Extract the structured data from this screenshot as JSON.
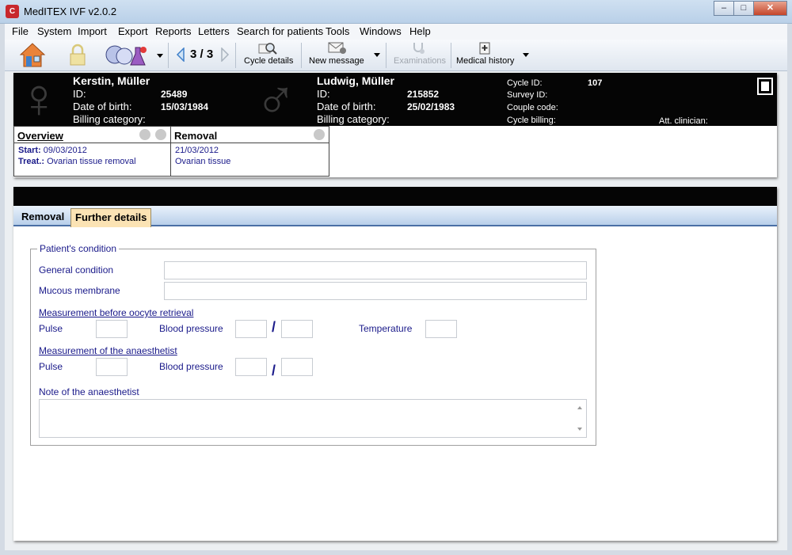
{
  "window": {
    "title": "MedITEX IVF v2.0.2",
    "app_icon_text": "C"
  },
  "menu": [
    "File",
    "System",
    "Import",
    "Export",
    "Reports",
    "Letters",
    "Search for patients",
    "Tools",
    "Windows",
    "Help"
  ],
  "toolbar": {
    "pager": "3 / 3",
    "cycle_details": "Cycle details",
    "new_message": "New message",
    "examinations": "Examinations",
    "medical_history": "Medical history"
  },
  "female": {
    "name": "Kerstin, Müller",
    "id_label": "ID:",
    "id": "25489",
    "dob_label": "Date of birth:",
    "dob": "15/03/1984",
    "billing_label": "Billing category:"
  },
  "male": {
    "name": "Ludwig, Müller",
    "id_label": "ID:",
    "id": "215852",
    "dob_label": "Date of birth:",
    "dob": "25/02/1983",
    "billing_label": "Billing category:"
  },
  "cycle": {
    "cycle_id_label": "Cycle ID:",
    "cycle_id": "107",
    "survey_id_label": "Survey ID:",
    "couple_code_label": "Couple code:",
    "cycle_billing_label": "Cycle billing:",
    "clinician_label": "Att. clinician:"
  },
  "overview": {
    "title": "Overview",
    "start_label": "Start:",
    "start": "09/03/2012",
    "treat_label": "Treat.:",
    "treat": "Ovarian tissue removal"
  },
  "removal_card": {
    "title": "Removal",
    "date": "21/03/2012",
    "desc": "Ovarian tissue"
  },
  "tabs": {
    "removal": "Removal",
    "further": "Further details"
  },
  "form": {
    "group_title": "Patient's condition",
    "general_condition": "General condition",
    "mucous_membrane": "Mucous membrane",
    "measure_before": "Measurement before oocyte retrieval",
    "pulse": "Pulse",
    "blood_pressure": "Blood pressure",
    "slash": "/",
    "temperature": "Temperature",
    "measure_anaesthetist": "Measurement of the anaesthetist",
    "note": "Note of the anaesthetist"
  }
}
